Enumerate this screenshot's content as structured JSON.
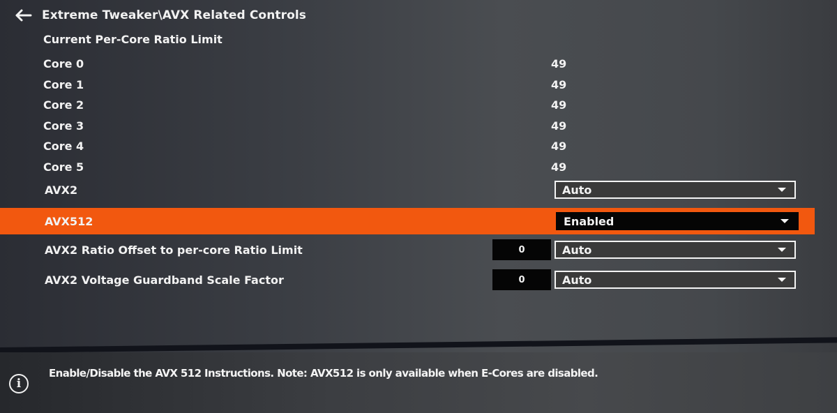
{
  "header": {
    "back_icon": "arrow-left-icon",
    "title": "Extreme Tweaker\\AVX Related Controls"
  },
  "section_label": "Current Per-Core Ratio Limit",
  "cores": [
    {
      "label": "Core 0",
      "value": "49"
    },
    {
      "label": "Core 1",
      "value": "49"
    },
    {
      "label": "Core 2",
      "value": "49"
    },
    {
      "label": "Core 3",
      "value": "49"
    },
    {
      "label": "Core 4",
      "value": "49"
    },
    {
      "label": "Core 5",
      "value": "49"
    }
  ],
  "settings": [
    {
      "label": "AVX2",
      "value": "Auto",
      "selected": false
    },
    {
      "label": "AVX512",
      "value": "Enabled",
      "selected": true
    },
    {
      "label": "AVX2 Ratio Offset to per-core Ratio Limit",
      "numeric": "0",
      "value": "Auto",
      "selected": false
    },
    {
      "label": "AVX2 Voltage Guardband Scale Factor",
      "numeric": "0",
      "value": "Auto",
      "selected": false
    }
  ],
  "footer": {
    "info_icon": "info-icon",
    "help_text": "Enable/Disable the AVX 512 Instructions. Note: AVX512 is only available when E-Cores are disabled."
  },
  "colors": {
    "highlight": "#f2580f",
    "background": "#3b3e44",
    "text": "#f2f2f2"
  }
}
